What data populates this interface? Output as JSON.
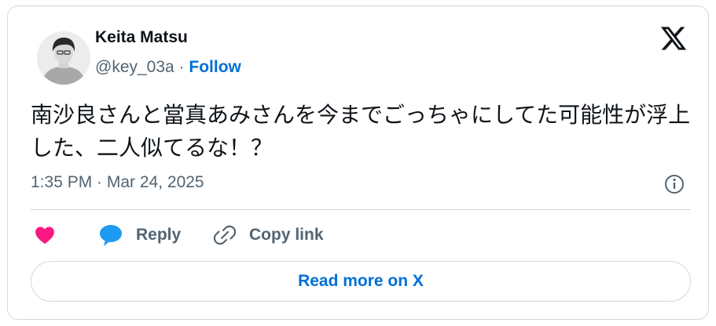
{
  "author": {
    "display_name": "Keita Matsu",
    "handle": "@key_03a",
    "separator": " · ",
    "follow_label": "Follow"
  },
  "tweet": {
    "text": "南沙良さんと當真あみさんを今までごっちゃにしてた可能性が浮上した、二人似てるな！？",
    "timestamp": "1:35 PM · Mar 24, 2025"
  },
  "actions": {
    "like_icon": "heart-icon",
    "reply_label": "Reply",
    "copy_label": "Copy link"
  },
  "read_more_label": "Read more on X",
  "colors": {
    "accent": "#006fd6",
    "like": "#f91880",
    "reply_icon": "#1d9bf0",
    "text": "#0f1419",
    "muted": "#536471",
    "border": "#cfd9de"
  }
}
